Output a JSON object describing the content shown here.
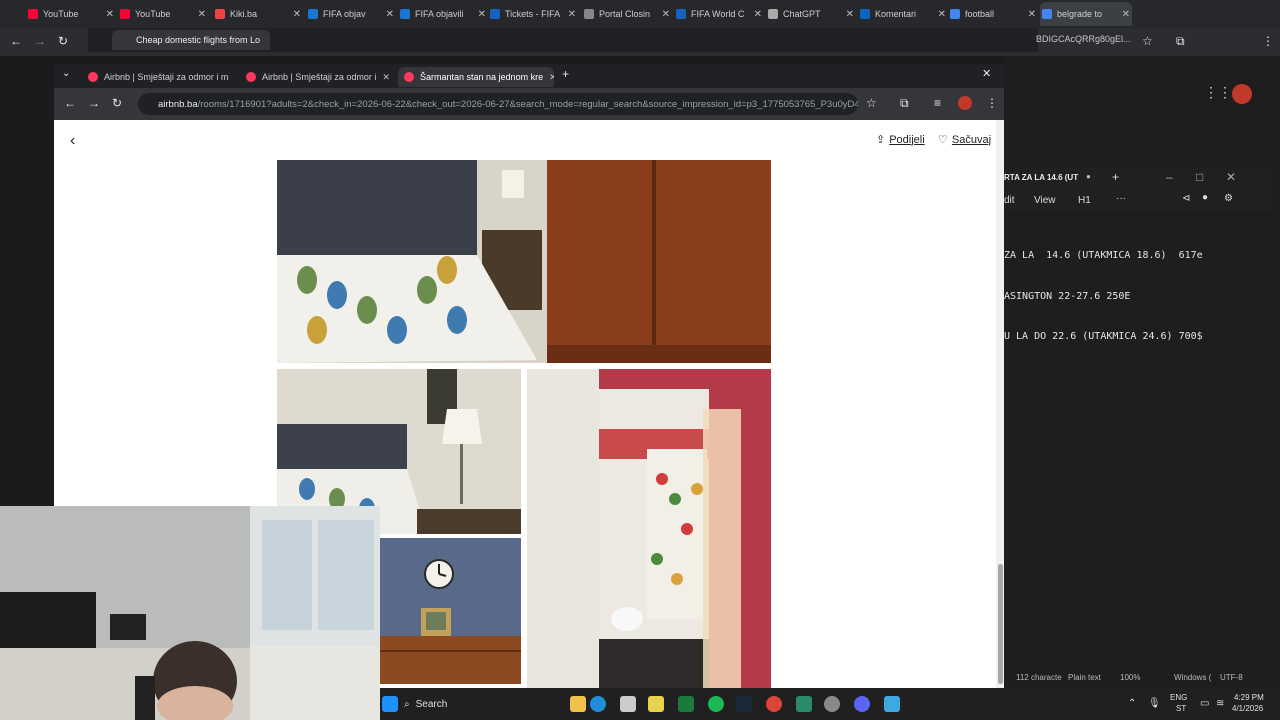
{
  "back_browser": {
    "tabs": [
      {
        "label": "YouTube",
        "color": "#ff0033"
      },
      {
        "label": "YouTube",
        "color": "#ff0033"
      },
      {
        "label": "Kiki.ba",
        "color": "#e44"
      },
      {
        "label": "FIFA objav",
        "color": "#1976d2"
      },
      {
        "label": "FIFA objavili",
        "color": "#1976d2"
      },
      {
        "label": "Tickets - FIFA",
        "color": "#1565c0"
      },
      {
        "label": "Portal Closin",
        "color": "#888"
      },
      {
        "label": "FIFA World C",
        "color": "#1565c0"
      },
      {
        "label": "ChatGPT",
        "color": "#aaa"
      },
      {
        "label": "Komentari",
        "color": "#0a66c2"
      },
      {
        "label": "football",
        "color": "#4285f4"
      },
      {
        "label": "belgrade to",
        "color": "#4285f4"
      }
    ],
    "inner_active_tab": "Cheap domestic flights from Lo",
    "url_fragment": "BDIGCAcQRRg80gEl..."
  },
  "front_browser": {
    "tabs": [
      {
        "label": "Airbnb | Smještaji za odmor i m",
        "active": false
      },
      {
        "label": "Airbnb | Smještaji za odmor i",
        "active": false
      },
      {
        "label": "Šarmantan stan na jednom kre",
        "active": true
      }
    ],
    "url_host": "airbnb.ba",
    "url_path": "/rooms/1716901?adults=2&check_in=2026-06-22&check_out=2026-06-27&search_mode=regular_search&source_impression_id=p3_1775053765_P3u0yD4t8..."
  },
  "page": {
    "share_label": "Podijeli",
    "save_label": "Sačuvaj"
  },
  "notepad": {
    "tab_title": "RTA ZA LA 14.6 (UT",
    "menu": [
      "dit",
      "View",
      "H1"
    ],
    "lines": [
      "ZA LA  14.6 (UTAKMICA 18.6)  617e",
      "ASINGTON 22-27.6 250E",
      "U LA DO 22.6 (UTAKMICA 24.6) 700$"
    ],
    "status": [
      "112 characte",
      "Plain text",
      "100%",
      "Windows (",
      "UTF-8"
    ]
  },
  "taskbar": {
    "search_label": "Search",
    "lang": "ENG",
    "lang2": "ST",
    "time": "4:29 PM",
    "date": "4/1/2026",
    "icons": [
      "start-icon",
      "search-icon",
      "file-explorer-icon",
      "edge-icon",
      "store-icon",
      "notes-icon",
      "excel-icon",
      "spotify-icon",
      "steam-icon",
      "chrome-icon",
      "app-icon",
      "settings-icon",
      "discord-icon",
      "notepad-icon"
    ]
  }
}
